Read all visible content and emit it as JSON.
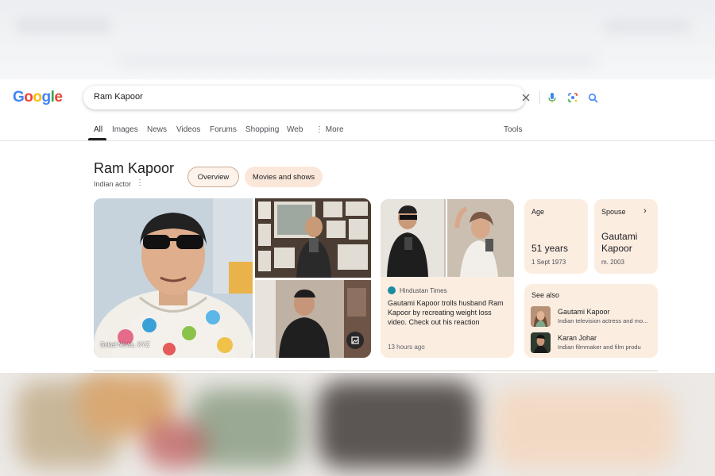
{
  "logo": {
    "letters": [
      "G",
      "o",
      "o",
      "g",
      "l",
      "e"
    ],
    "colors": [
      "#4285F4",
      "#EA4335",
      "#FBBC05",
      "#4285F4",
      "#34A853",
      "#EA4335"
    ]
  },
  "search": {
    "query": "Ram Kapoor"
  },
  "tabs": [
    {
      "label": "All",
      "active": true
    },
    {
      "label": "Images"
    },
    {
      "label": "News"
    },
    {
      "label": "Videos"
    },
    {
      "label": "Forums"
    },
    {
      "label": "Shopping"
    },
    {
      "label": "Web"
    },
    {
      "label": "More"
    }
  ],
  "tools_label": "Tools",
  "entity": {
    "name": "Ram Kapoor",
    "subtitle": "Indian actor",
    "chips": [
      "Overview",
      "Movies and shows"
    ]
  },
  "collage": {
    "credit": "Sakal News, XYZ"
  },
  "news": {
    "source": "Hindustan Times",
    "headline": "Gautami Kapoor trolls husband Ram Kapoor by recreating weight loss video. Check out his reaction",
    "time": "13 hours ago"
  },
  "facts": {
    "age": {
      "label": "Age",
      "value": "51 years",
      "detail": "1 Sept 1973"
    },
    "spouse": {
      "label": "Spouse",
      "value": "Gautami Kapoor",
      "detail": "m. 2003"
    }
  },
  "see_also": {
    "heading": "See also",
    "items": [
      {
        "name": "Gautami Kapoor",
        "desc": "Indian television actress and mo..."
      },
      {
        "name": "Karan Johar",
        "desc": "Indian filmmaker and film produ"
      }
    ]
  },
  "icons": [
    "clear-icon",
    "mic-icon",
    "lens-icon",
    "search-icon",
    "more-dots-icon",
    "expand-image-icon",
    "chevron-right-icon"
  ]
}
